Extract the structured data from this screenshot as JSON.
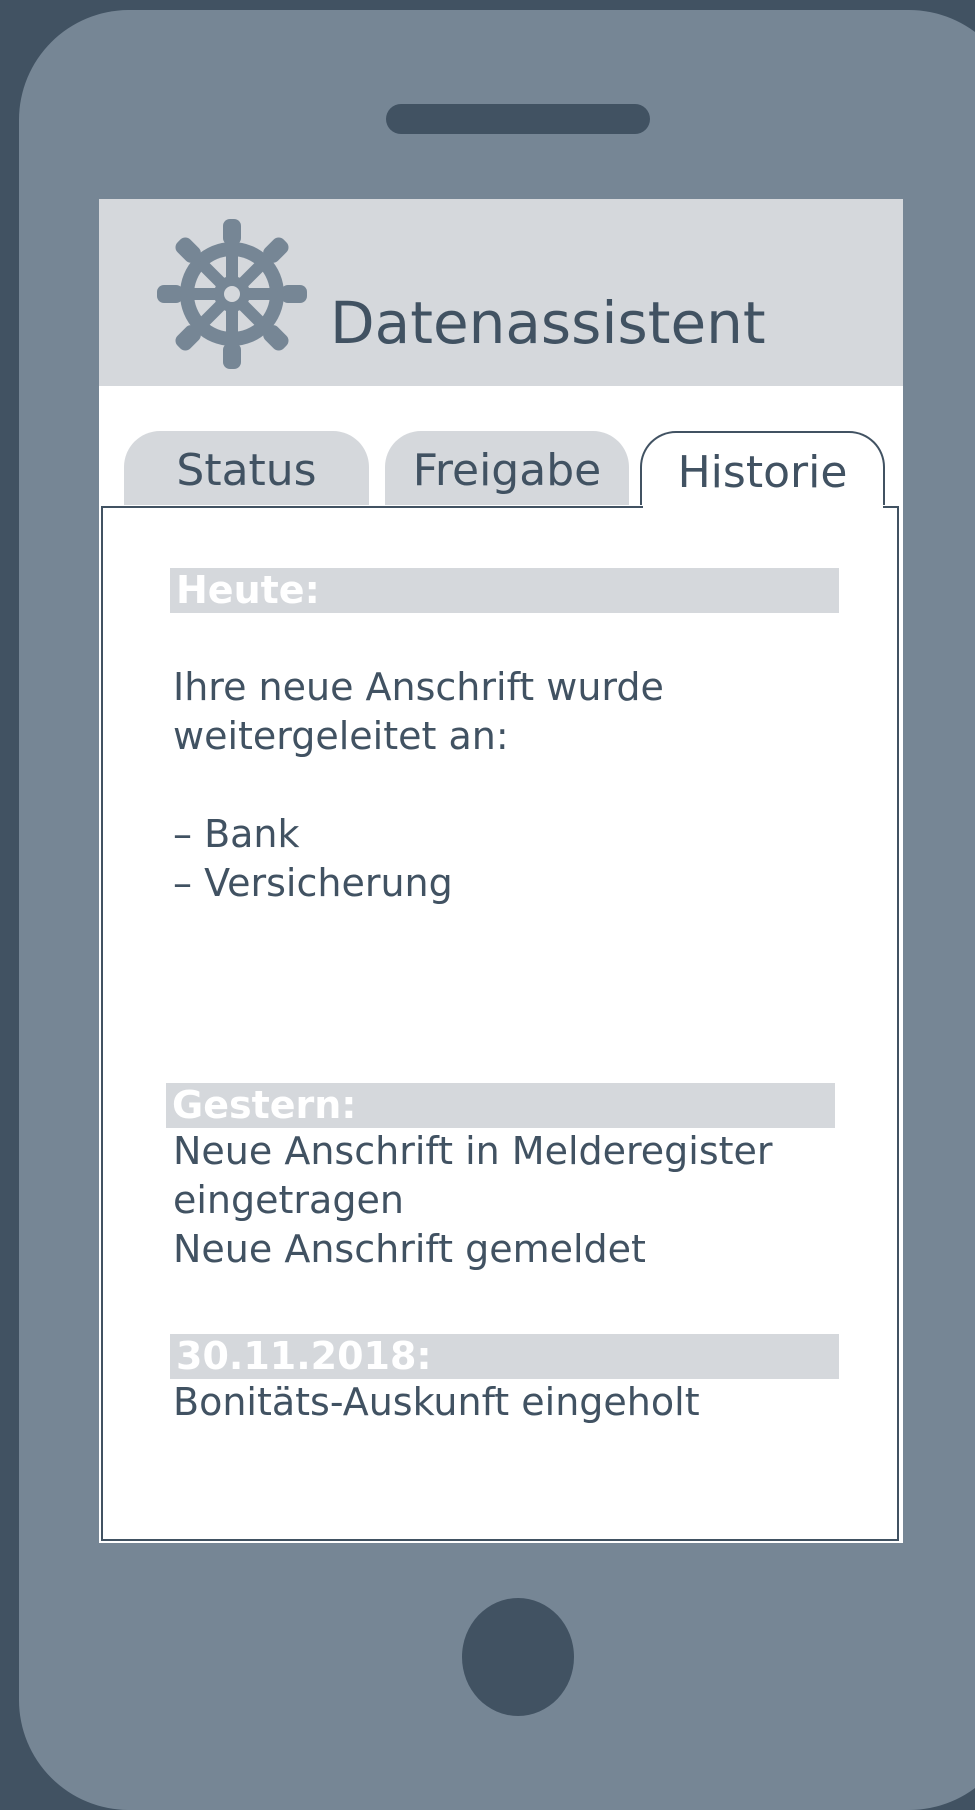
{
  "app": {
    "title": "Datenassistent",
    "icon": "gear-icon"
  },
  "tabs": [
    {
      "label": "Status",
      "active": false
    },
    {
      "label": "Freigabe",
      "active": false
    },
    {
      "label": "Historie",
      "active": true
    }
  ],
  "history": {
    "today": {
      "label": "Heute:",
      "lines": [
        "Ihre neue Anschrift wurde",
        "weitergeleitet an:",
        "",
        "– Bank",
        "– Versicherung"
      ]
    },
    "yesterday": {
      "label": "Gestern:",
      "lines": [
        "Neue Anschrift in Melderegister",
        "eingetragen",
        "Neue Anschrift gemeldet"
      ]
    },
    "date_entry": {
      "label": "30.11.2018:",
      "lines": [
        "Bonitäts-Auskunft eingeholt"
      ]
    }
  },
  "colors": {
    "dark": "#415262",
    "phone_body": "#768695",
    "light_gray": "#d5d8dc"
  }
}
